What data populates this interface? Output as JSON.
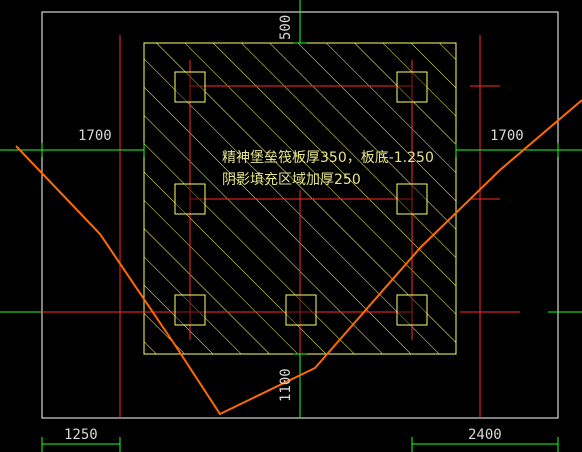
{
  "drawing": {
    "dimensions": {
      "top_offset": "500",
      "left_extension": "1700",
      "right_extension": "1700",
      "bottom_offset": "1100",
      "bottom_left": "1250",
      "bottom_right": "2400"
    },
    "note": {
      "line1": "精神堡垒筏板厚350，板底-1.250",
      "line2": "阴影填充区域加厚250"
    },
    "colors": {
      "background": "#000000",
      "frame": "#ffffff",
      "raft_outline": "#ffff66",
      "axis_lines": "#ff2a2a",
      "dimension_lines": "#21ff21",
      "section_cut": "#ff6a00",
      "text": "#d8d8d8"
    },
    "columns": [
      {
        "row": "top",
        "col": "left"
      },
      {
        "row": "top",
        "col": "right"
      },
      {
        "row": "middle",
        "col": "left"
      },
      {
        "row": "middle",
        "col": "right"
      },
      {
        "row": "bottom",
        "col": "left"
      },
      {
        "row": "bottom",
        "col": "center"
      },
      {
        "row": "bottom",
        "col": "right"
      }
    ]
  }
}
